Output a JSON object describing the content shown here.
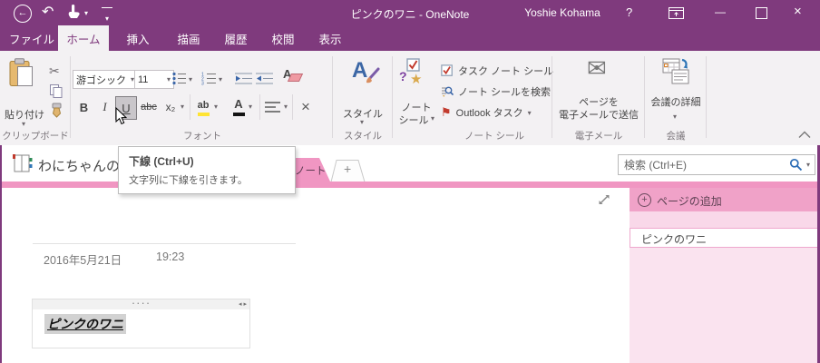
{
  "titlebar": {
    "title": "ピンクのワニ - OneNote",
    "user": "Yoshie Kohama"
  },
  "icons": {
    "back_arrow": "←",
    "undo": "↶",
    "caret_down": "▾",
    "help": "?",
    "minimize": "—",
    "close": "×",
    "scissors": "✂",
    "flag": "⚑",
    "envelope": "✉",
    "star": "★",
    "question": "?",
    "plus": "+",
    "delete_x": "×"
  },
  "tabs": [
    {
      "label": "ファイル"
    },
    {
      "label": "ホーム"
    },
    {
      "label": "挿入"
    },
    {
      "label": "描画"
    },
    {
      "label": "履歴"
    },
    {
      "label": "校閲"
    },
    {
      "label": "表示"
    }
  ],
  "ribbon": {
    "clipboard": {
      "paste": "貼り付け",
      "group": "クリップボード"
    },
    "font": {
      "name": "游ゴシック",
      "size": "11",
      "bold": "B",
      "italic": "I",
      "underline": "U",
      "strikethrough": "abc",
      "subscript": "x₂",
      "highlight": "ab",
      "fontcolor": "A",
      "group": "フォント"
    },
    "styles": {
      "label": "スタイル",
      "icon_letter": "A",
      "group": "スタイル"
    },
    "tags": {
      "label_line1": "ノート",
      "label_line2": "シール",
      "task": "タスク ノート シール",
      "find": "ノート シールを検索",
      "outlook": "Outlook タスク",
      "group": "ノート シール"
    },
    "email": {
      "line1": "ページを",
      "line2": "電子メールで送信",
      "group": "電子メール"
    },
    "meeting": {
      "label": "会議の詳細",
      "group": "会議"
    }
  },
  "tooltip": {
    "title": "下線 (Ctrl+U)",
    "description": "文字列に下線を引きます。"
  },
  "navbar": {
    "notebook": "わにちゃんの",
    "section": "ノート",
    "new_section": "+",
    "search_placeholder": "検索 (Ctrl+E)"
  },
  "sidebar": {
    "add_page": "ページの追加",
    "pages": [
      {
        "title": "ピンクのワニ"
      }
    ]
  },
  "canvas": {
    "date": "2016年5月21日",
    "time": "19:23",
    "note_text": "ピンクのワニ",
    "handle_dots": "····",
    "handle_arrows": "◂ ▸"
  },
  "colors": {
    "purple": "#7f3a7d",
    "pink_tab": "#f096c2",
    "pink_header": "#f0a2c8",
    "pink_panel": "#fae3ef",
    "pink_band": "#f9d8e9"
  }
}
